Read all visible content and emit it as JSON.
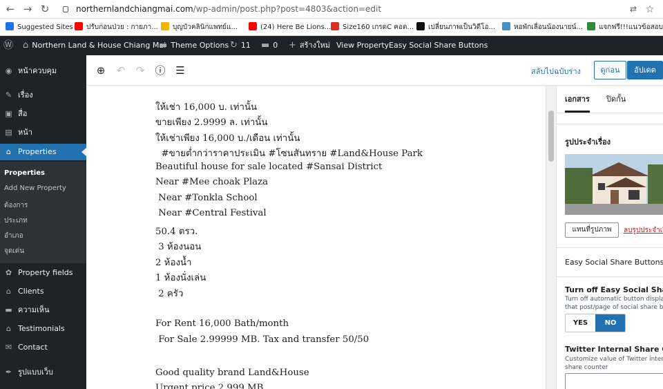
{
  "browser": {
    "url_host": "northernlandchiangmai.com",
    "url_path": "/wp-admin/post.php?post=4803&action=edit",
    "bookmarks": [
      {
        "label": "Suggested Sites",
        "color": "#1a73e8"
      },
      {
        "label": "ปรับก่อนป่วย : กายภา...",
        "color": "#ff0000"
      },
      {
        "label": "บุญบัวคลินิกแพทย์แ...",
        "color": "#f4b400"
      },
      {
        "label": "(24) Here Be Lions...",
        "color": "#ff0000"
      },
      {
        "label": "Size160 เกรดC คอต...",
        "color": "#d93025"
      },
      {
        "label": "เปลี่ยนภาพเป็นวิดีโอ...",
        "color": "#111111"
      },
      {
        "label": "หอพักเลื่อนน้องนายน์...",
        "color": "#4a90c2"
      },
      {
        "label": "แจกฟรี!!!แนวข้อสอบ...",
        "color": "#2e8b3a"
      }
    ]
  },
  "adminbar": {
    "site_name": "Northern Land & House Chiang Mai",
    "theme_options": "Theme Options",
    "updates_count": "11",
    "comments_count": "0",
    "new_label": "สร้างใหม่",
    "view_property": "View Property",
    "share_buttons": "Easy Social Share Buttons"
  },
  "sidebar": {
    "items": [
      {
        "label": "หน้าควบคุม",
        "icon": "dashboard-icon",
        "glyph": "◉"
      },
      {
        "label": "เรื่อง",
        "icon": "pin-icon",
        "glyph": "✎"
      },
      {
        "label": "สื่อ",
        "icon": "media-icon",
        "glyph": "▣"
      },
      {
        "label": "หน้า",
        "icon": "page-icon",
        "glyph": "▤"
      },
      {
        "label": "Properties",
        "icon": "home-icon",
        "glyph": "⌂"
      },
      {
        "label": "Property fields",
        "icon": "gear-icon",
        "glyph": "✿"
      },
      {
        "label": "Clients",
        "icon": "home-icon",
        "glyph": "⌂"
      },
      {
        "label": "ความเห็น",
        "icon": "comment-icon",
        "glyph": "▬"
      },
      {
        "label": "Testimonials",
        "icon": "home-icon",
        "glyph": "⌂"
      },
      {
        "label": "Contact",
        "icon": "mail-icon",
        "glyph": "✉"
      },
      {
        "label": "รูปแบบเว็บ",
        "icon": "brush-icon",
        "glyph": "✒"
      }
    ],
    "subitems": [
      "Properties",
      "Add New Property",
      "ต้องการ",
      "ประเภท",
      "อำเภอ",
      "จุดเด่น"
    ]
  },
  "editor": {
    "switch_draft": "สลับไปฉบับร่าง",
    "preview": "ดูก่อน",
    "update": "อัปเดต",
    "lines": [
      "ให้เช่า 16,000 บ. เท่านั้น",
      "ขายเพียง 2.9999 ล. เท่านั้น",
      "ให้เช่าเพียง 16,000 บ./เดือน เท่านั้น",
      "  #ขายต่ำกว่าราคาประเมิน #โซนสันทราย #Land&House Park",
      "Beautiful house for sale located #Sansai District",
      "Near #Mee choak Plaza",
      " Near #Tonkla School",
      " Near #Central Festival",
      "50.4 ตรว.",
      " 3 ห้องนอน",
      "2 ห้องน้ำ",
      "1 ห้องนั่งเล่น",
      " 2 ครัว",
      "",
      "For Rent 16,000 Bath/month",
      " For Sale 2.99999 MB. Tax and transfer 50/50",
      "",
      "Good quality brand Land&House",
      "Urgent price 2,999 MB."
    ]
  },
  "settings": {
    "tab_document": "เอกสาร",
    "tab_block": "ปิดกั้น",
    "featured_image_title": "รูปประจำเรื่อง",
    "replace_image": "แทนที่รูปภาพ",
    "remove_image": "ลบรูปประจำเรื่อง",
    "share_panel": "Easy Social Share Buttons",
    "turn_off_title": "Turn off Easy Social Share Buttons",
    "turn_off_desc_1": "Turn off automatic button display",
    "turn_off_desc_2": "that post/page of social share buttons",
    "yes": "YES",
    "no": "NO",
    "twitter_title": "Twitter Internal Share Counter",
    "twitter_desc_1": "Customize value of Twitter internal",
    "twitter_desc_2": "share counter"
  }
}
